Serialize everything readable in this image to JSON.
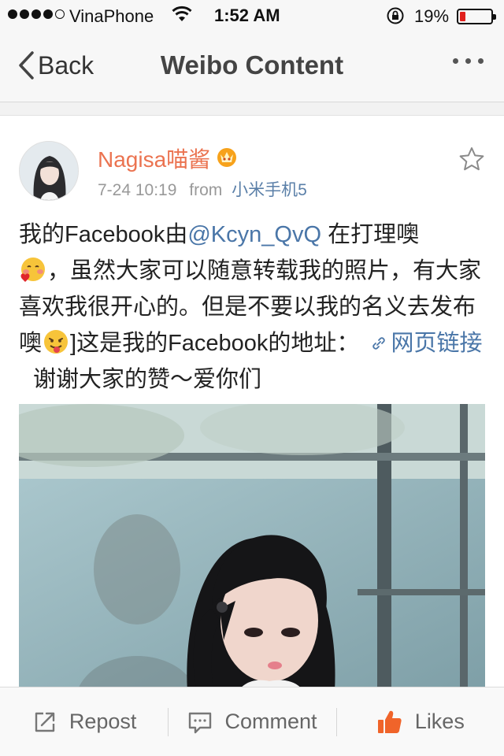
{
  "status_bar": {
    "carrier": "VinaPhone",
    "time": "1:52 AM",
    "battery_percent": "19%",
    "battery_level": 0.19,
    "signal_bars_filled": 4,
    "signal_bars_total": 5
  },
  "nav": {
    "back_label": "Back",
    "title": "Weibo Content"
  },
  "post": {
    "username": "Nagisa喵酱",
    "timestamp": "7-24 10:19",
    "from_label": "from",
    "source": "小米手机5",
    "text_1": "我的Facebook由",
    "mention": "@Kcyn_QvQ",
    "text_2": " 在打理噢",
    "text_3": "，虽然大家可以随意转载我的照片，有大家喜欢我很开心的。但是不要以我的名义去发布噢",
    "text_4": "]这是我的Facebook的地址：",
    "link_text": "网页链接",
    "text_5": "谢谢大家的赞～爱你们"
  },
  "toolbar": {
    "repost_label": "Repost",
    "comment_label": "Comment",
    "likes_label": "Likes"
  },
  "colors": {
    "username": "#eb7350",
    "link": "#4a76a8",
    "battery_low": "#e0201d",
    "like_icon": "#f0642a"
  }
}
